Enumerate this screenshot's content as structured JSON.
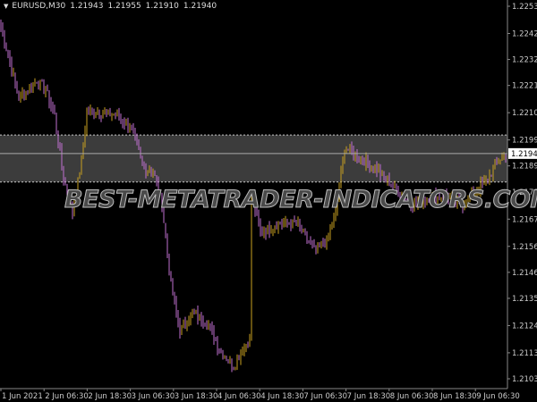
{
  "header": {
    "symbol": "EURUSD,M30",
    "open": "1.21943",
    "high": "1.21955",
    "low": "1.21910",
    "close": "1.21940"
  },
  "watermark": "BEST-METATRADER-INDICATORS.COM",
  "colors": {
    "bull": "#c8a020",
    "bear": "#c070d0",
    "zone": "#3c3c3c",
    "grid": "#888888"
  },
  "chart_data": {
    "type": "candlestick",
    "symbol": "EURUSD",
    "timeframe": "M30",
    "y_ticks": [
      "1.22535",
      "1.22425",
      "1.22320",
      "1.22215",
      "1.22105",
      "1.21995",
      "1.21890",
      "1.21785",
      "1.21675",
      "1.21565",
      "1.21460",
      "1.21355",
      "1.21245",
      "1.21135",
      "1.21030"
    ],
    "ylim": [
      1.2101,
      1.2256
    ],
    "current_price": "1.21940",
    "zone": {
      "top": 1.22015,
      "bottom": 1.21825
    },
    "x_ticks": [
      "1 Jun 2021",
      "2 Jun 06:30",
      "2 Jun 18:30",
      "3 Jun 06:30",
      "3 Jun 18:30",
      "4 Jun 06:30",
      "4 Jun 18:30",
      "7 Jun 06:30",
      "7 Jun 18:30",
      "8 Jun 06:30",
      "8 Jun 18:30",
      "9 Jun 06:30"
    ],
    "bars": 283,
    "path": [
      [
        0,
        1.22452
      ],
      [
        5,
        1.22308
      ],
      [
        10,
        1.22163
      ],
      [
        15,
        1.22199
      ],
      [
        20,
        1.22235
      ],
      [
        25,
        1.22199
      ],
      [
        30,
        1.22091
      ],
      [
        35,
        1.21838
      ],
      [
        40,
        1.21694
      ],
      [
        45,
        1.2191
      ],
      [
        48,
        1.22109
      ],
      [
        53,
        1.22109
      ],
      [
        65,
        1.22091
      ],
      [
        72,
        1.22055
      ],
      [
        80,
        1.21874
      ],
      [
        85,
        1.21874
      ],
      [
        90,
        1.2173
      ],
      [
        95,
        1.21405
      ],
      [
        100,
        1.21225
      ],
      [
        107,
        1.21297
      ],
      [
        115,
        1.21261
      ],
      [
        122,
        1.21152
      ],
      [
        130,
        1.2108
      ],
      [
        135,
        1.21152
      ],
      [
        139,
        1.21189
      ],
      [
        140,
        1.21766
      ],
      [
        145,
        1.21622
      ],
      [
        155,
        1.21658
      ],
      [
        165,
        1.21658
      ],
      [
        175,
        1.2155
      ],
      [
        182,
        1.21586
      ],
      [
        187,
        1.21694
      ],
      [
        192,
        1.21965
      ],
      [
        200,
        1.21929
      ],
      [
        210,
        1.21874
      ],
      [
        220,
        1.21802
      ],
      [
        230,
        1.2173
      ],
      [
        240,
        1.21766
      ],
      [
        250,
        1.21766
      ],
      [
        257,
        1.2173
      ],
      [
        265,
        1.21784
      ],
      [
        272,
        1.21838
      ],
      [
        280,
        1.21929
      ],
      [
        282,
        1.2194
      ]
    ]
  }
}
